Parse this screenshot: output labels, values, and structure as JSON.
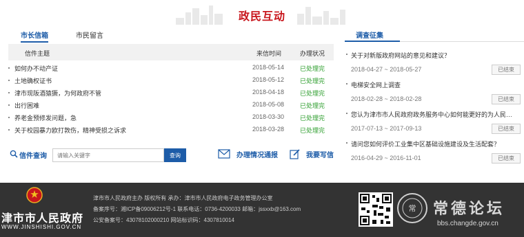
{
  "section": {
    "title": "政民互动"
  },
  "left": {
    "tabs": [
      {
        "label": "市长信箱"
      },
      {
        "label": "市民留言"
      }
    ],
    "table": {
      "headers": [
        "信件主题",
        "来信时间",
        "办理状况"
      ],
      "rows": [
        {
          "subject": "如何办不动产证",
          "date": "2018-05-14",
          "status": "已处理完"
        },
        {
          "subject": "土地确权证书",
          "date": "2018-05-12",
          "status": "已处理完"
        },
        {
          "subject": "津市现阪酒猿獗，为何政府不管",
          "date": "2018-04-18",
          "status": "已处理完"
        },
        {
          "subject": "出行困难",
          "date": "2018-05-08",
          "status": "已处理完"
        },
        {
          "subject": "养老金预修发问题，急",
          "date": "2018-03-30",
          "status": "已处理完"
        },
        {
          "subject": "关于校园暴力欧打敦伤，精神受损之诉求",
          "date": "2018-03-28",
          "status": "已处理完"
        }
      ]
    },
    "search": {
      "label": "信件查询",
      "placeholder": "请输入关键字",
      "button": "查询"
    },
    "links": {
      "report": "办理情况通报",
      "write": "我要写信"
    }
  },
  "right": {
    "title": "调查征集",
    "surveys": [
      {
        "question": "关于对新版政府网站的意见和建议？",
        "range": "2018-04-27 ~ 2018-05-27",
        "badge": "已结束"
      },
      {
        "question": "电梯安全网上调查",
        "range": "2018-02-28 ~ 2018-02-28",
        "badge": "已结束"
      },
      {
        "question": "您认为津市市人民政府政务服务中心如何能更好的为人民服务？",
        "range": "2017-07-13 ~ 2017-09-13",
        "badge": "已结束"
      },
      {
        "question": "请问您如何评价工业集中区基础设施建设及生活配套？",
        "range": "2016-04-29 ~ 2016-11-01",
        "badge": "已结束"
      }
    ]
  },
  "footer": {
    "name": "津市市人民政府",
    "domain": "WWW.JINSHISHI.GOV.CN",
    "info": [
      "津市市人民政府主办 版权所有 承办：津市市人民政府电子政务管理办公室",
      "备案序号：湘ICP备09006212号-1 联系电话：0736-4200033 邮箱：jssxxb@163.com",
      "公安备案号：43078102000210  网站标识码：4307810014"
    ]
  },
  "watermark": {
    "title": "常德论坛",
    "url": "bbs.changde.gov.cn",
    "ring_text": "bbs.changde.gov.cn"
  },
  "colors": {
    "accent": "#1d5ca8",
    "title_red": "#c8161d",
    "done_green": "#2e9e2e",
    "footer_bg": "#333333"
  }
}
